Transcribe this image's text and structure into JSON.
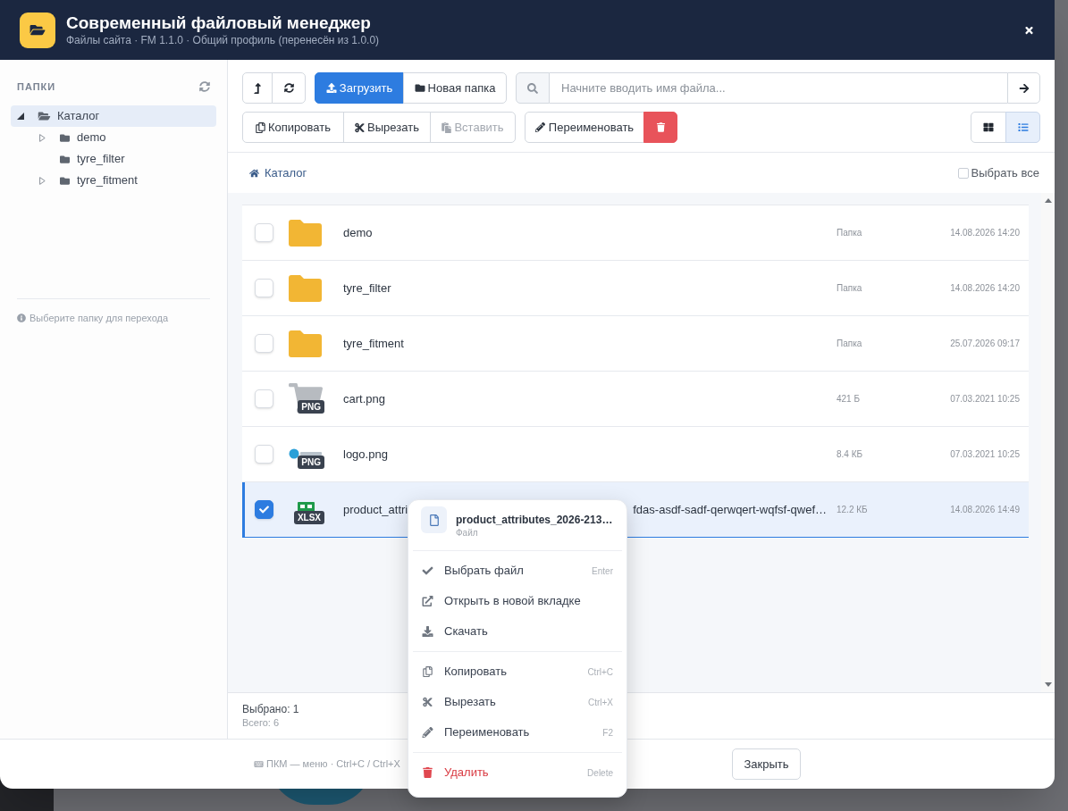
{
  "window": {
    "title": "Современный файловый менеджер",
    "subtitle": "Файлы сайта · FM 1.1.0 · Общий профиль (перенесён из 1.0.0)"
  },
  "sidebar": {
    "heading": "ПАПКИ",
    "tree": [
      {
        "label": "Каталог",
        "expandable": true,
        "expanded": true,
        "selected": true,
        "children": [
          {
            "label": "demo",
            "expandable": true,
            "expanded": false,
            "selected": false
          },
          {
            "label": "tyre_filter",
            "expandable": false,
            "expanded": false,
            "selected": false
          },
          {
            "label": "tyre_fitment",
            "expandable": true,
            "expanded": false,
            "selected": false
          }
        ]
      }
    ],
    "hint": "Выберите папку для перехода"
  },
  "toolbar": {
    "actions": [
      {
        "label": "Загрузить",
        "kind": "primary"
      },
      {
        "label": "Новая папка",
        "kind": "default"
      }
    ],
    "search": {
      "placeholder": "Начните вводить имя файла..."
    },
    "edit_actions": [
      {
        "label": "Копировать",
        "disabled": false
      },
      {
        "label": "Вырезать",
        "disabled": false
      },
      {
        "label": "Вставить",
        "disabled": true
      }
    ],
    "rename": {
      "label": "Переименовать"
    },
    "view_modes": [
      {
        "selected": false
      },
      {
        "selected": true
      }
    ]
  },
  "breadcrumb": [
    {
      "label": "Каталог"
    }
  ],
  "select_all": {
    "label": "Выбрать все",
    "checked": false
  },
  "files": [
    {
      "kind": "folder",
      "name": "demo",
      "info": "Папка",
      "modified": "14.08.2026 14:20",
      "selected": false
    },
    {
      "kind": "folder",
      "name": "tyre_filter",
      "info": "Папка",
      "modified": "14.08.2026 14:20",
      "selected": false
    },
    {
      "kind": "folder",
      "name": "tyre_fitment",
      "info": "Папка",
      "modified": "25.07.2026 09:17",
      "selected": false
    },
    {
      "kind": "image",
      "name": "cart.png",
      "badge": "PNG",
      "info": "421 Б",
      "modified": "07.03.2021 10:25",
      "selected": false
    },
    {
      "kind": "image",
      "name": "logo.png",
      "badge": "PNG",
      "info": "8.4 КБ",
      "modified": "07.03.2021 10:25",
      "selected": false
    },
    {
      "kind": "spreadsheet",
      "name": "product_attri",
      "name_end": "fdas-asdf-sadf-qerwqert-wqfsf-qwef…",
      "badge": "XLSX",
      "info": "12.2 КБ",
      "modified": "14.08.2026 14:49",
      "selected": true
    }
  ],
  "status": {
    "selected": "Выбрано: 1",
    "total": "Всего: 6"
  },
  "footer": {
    "hint": "ПКМ — меню · Ctrl+C / Ctrl+X",
    "close_button": "Закрыть"
  },
  "context_menu": {
    "title": "product_attributes_2026-213…",
    "subtitle": "Файл",
    "groups": [
      [
        {
          "label": "Выбрать файл",
          "shortcut": "Enter",
          "danger": false
        },
        {
          "label": "Открыть в новой вкладке",
          "danger": false
        },
        {
          "label": "Скачать",
          "danger": false
        }
      ],
      [
        {
          "label": "Копировать",
          "shortcut": "Ctrl+C",
          "danger": false
        },
        {
          "label": "Вырезать",
          "shortcut": "Ctrl+X",
          "danger": false
        },
        {
          "label": "Переименовать",
          "shortcut": "F2",
          "danger": false
        }
      ],
      [
        {
          "label": "Удалить",
          "shortcut": "Delete",
          "danger": true
        }
      ]
    ]
  }
}
